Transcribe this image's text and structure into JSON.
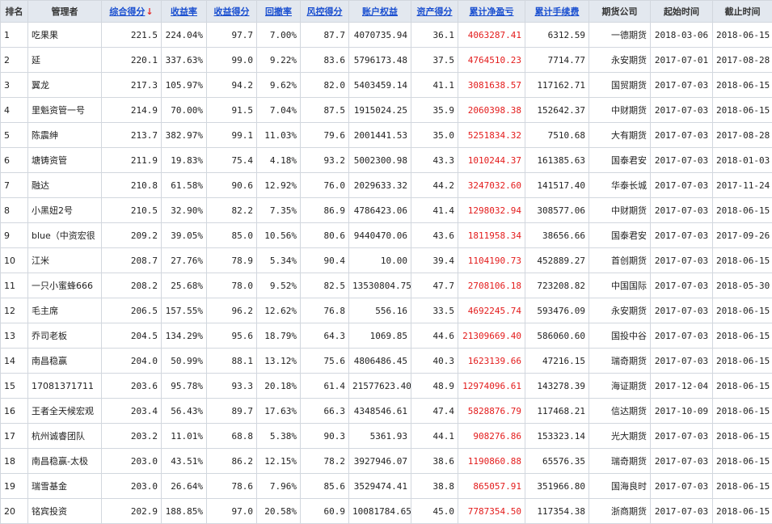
{
  "headers": {
    "rank": "排名",
    "manager": "管理者",
    "total_score": "综合得分",
    "sort_arrow": "↓",
    "return_rate": "收益率",
    "return_score": "收益得分",
    "drawdown": "回撤率",
    "risk_score": "风控得分",
    "equity": "账户权益",
    "asset_score": "资产得分",
    "net_profit": "累计净盈亏",
    "fees": "累计手续费",
    "company": "期货公司",
    "start": "起始时间",
    "end": "截止时间"
  },
  "rows": [
    {
      "rank": "1",
      "manager": "吃果果",
      "total": "221.5",
      "ret": "224.04%",
      "ret_score": "97.7",
      "dd": "7.00%",
      "risk": "87.7",
      "equity": "4070735.94",
      "asset": "36.1",
      "net": "4063287.41",
      "fees": "6312.59",
      "company": "一德期货",
      "start": "2018-03-06",
      "end": "2018-06-15"
    },
    {
      "rank": "2",
      "manager": "延",
      "total": "220.1",
      "ret": "337.63%",
      "ret_score": "99.0",
      "dd": "9.22%",
      "risk": "83.6",
      "equity": "5796173.48",
      "asset": "37.5",
      "net": "4764510.23",
      "fees": "7714.77",
      "company": "永安期货",
      "start": "2017-07-01",
      "end": "2017-08-28"
    },
    {
      "rank": "3",
      "manager": "翼龙",
      "total": "217.3",
      "ret": "105.97%",
      "ret_score": "94.2",
      "dd": "9.62%",
      "risk": "82.0",
      "equity": "5403459.14",
      "asset": "41.1",
      "net": "3081638.57",
      "fees": "117162.71",
      "company": "国贸期货",
      "start": "2017-07-03",
      "end": "2018-06-15"
    },
    {
      "rank": "4",
      "manager": "里魁资管一号",
      "total": "214.9",
      "ret": "70.00%",
      "ret_score": "91.5",
      "dd": "7.04%",
      "risk": "87.5",
      "equity": "1915024.25",
      "asset": "35.9",
      "net": "2060398.38",
      "fees": "152642.37",
      "company": "中财期货",
      "start": "2017-07-03",
      "end": "2018-06-15"
    },
    {
      "rank": "5",
      "manager": "陈震绅",
      "total": "213.7",
      "ret": "382.97%",
      "ret_score": "99.1",
      "dd": "11.03%",
      "risk": "79.6",
      "equity": "2001441.53",
      "asset": "35.0",
      "net": "5251834.32",
      "fees": "7510.68",
      "company": "大有期货",
      "start": "2017-07-03",
      "end": "2017-08-28"
    },
    {
      "rank": "6",
      "manager": "塘铸资管",
      "total": "211.9",
      "ret": "19.83%",
      "ret_score": "75.4",
      "dd": "4.18%",
      "risk": "93.2",
      "equity": "5002300.98",
      "asset": "43.3",
      "net": "1010244.37",
      "fees": "161385.63",
      "company": "国泰君安",
      "start": "2017-07-03",
      "end": "2018-01-03"
    },
    {
      "rank": "7",
      "manager": "融达",
      "total": "210.8",
      "ret": "61.58%",
      "ret_score": "90.6",
      "dd": "12.92%",
      "risk": "76.0",
      "equity": "2029633.32",
      "asset": "44.2",
      "net": "3247032.60",
      "fees": "141517.40",
      "company": "华泰长城",
      "start": "2017-07-03",
      "end": "2017-11-24"
    },
    {
      "rank": "8",
      "manager": "小黑妞2号",
      "total": "210.5",
      "ret": "32.90%",
      "ret_score": "82.2",
      "dd": "7.35%",
      "risk": "86.9",
      "equity": "4786423.06",
      "asset": "41.4",
      "net": "1298032.94",
      "fees": "308577.06",
      "company": "中财期货",
      "start": "2017-07-03",
      "end": "2018-06-15"
    },
    {
      "rank": "9",
      "manager": "blue（中资宏很",
      "total": "209.2",
      "ret": "39.05%",
      "ret_score": "85.0",
      "dd": "10.56%",
      "risk": "80.6",
      "equity": "9440470.06",
      "asset": "43.6",
      "net": "1811958.34",
      "fees": "38656.66",
      "company": "国泰君安",
      "start": "2017-07-03",
      "end": "2017-09-26"
    },
    {
      "rank": "10",
      "manager": "江米",
      "total": "208.7",
      "ret": "27.76%",
      "ret_score": "78.9",
      "dd": "5.34%",
      "risk": "90.4",
      "equity": "10.00",
      "asset": "39.4",
      "net": "1104190.73",
      "fees": "452889.27",
      "company": "首创期货",
      "start": "2017-07-03",
      "end": "2018-06-15"
    },
    {
      "rank": "11",
      "manager": "一只小蜜蜂666",
      "total": "208.2",
      "ret": "25.68%",
      "ret_score": "78.0",
      "dd": "9.52%",
      "risk": "82.5",
      "equity": "13530804.75",
      "asset": "47.7",
      "net": "2708106.18",
      "fees": "723208.82",
      "company": "中国国际",
      "start": "2017-07-03",
      "end": "2018-05-30"
    },
    {
      "rank": "12",
      "manager": "毛主席",
      "total": "206.5",
      "ret": "157.55%",
      "ret_score": "96.2",
      "dd": "12.62%",
      "risk": "76.8",
      "equity": "556.16",
      "asset": "33.5",
      "net": "4692245.74",
      "fees": "593476.09",
      "company": "永安期货",
      "start": "2017-07-03",
      "end": "2018-06-15"
    },
    {
      "rank": "13",
      "manager": "乔司老板",
      "total": "204.5",
      "ret": "134.29%",
      "ret_score": "95.6",
      "dd": "18.79%",
      "risk": "64.3",
      "equity": "1069.85",
      "asset": "44.6",
      "net": "21309669.40",
      "fees": "586060.60",
      "company": "国投中谷",
      "start": "2017-07-03",
      "end": "2018-06-15"
    },
    {
      "rank": "14",
      "manager": "南昌稳赢",
      "total": "204.0",
      "ret": "50.99%",
      "ret_score": "88.1",
      "dd": "13.12%",
      "risk": "75.6",
      "equity": "4806486.45",
      "asset": "40.3",
      "net": "1623139.66",
      "fees": "47216.15",
      "company": "瑞奇期货",
      "start": "2017-07-03",
      "end": "2018-06-15"
    },
    {
      "rank": "15",
      "manager": "17081371711",
      "total": "203.6",
      "ret": "95.78%",
      "ret_score": "93.3",
      "dd": "20.18%",
      "risk": "61.4",
      "equity": "21577623.40",
      "asset": "48.9",
      "net": "12974096.61",
      "fees": "143278.39",
      "company": "海证期货",
      "start": "2017-12-04",
      "end": "2018-06-15"
    },
    {
      "rank": "16",
      "manager": "王者全天候宏观",
      "total": "203.4",
      "ret": "56.43%",
      "ret_score": "89.7",
      "dd": "17.63%",
      "risk": "66.3",
      "equity": "4348546.61",
      "asset": "47.4",
      "net": "5828876.79",
      "fees": "117468.21",
      "company": "信达期货",
      "start": "2017-10-09",
      "end": "2018-06-15"
    },
    {
      "rank": "17",
      "manager": "杭州诚睿团队",
      "total": "203.2",
      "ret": "11.01%",
      "ret_score": "68.8",
      "dd": "5.38%",
      "risk": "90.3",
      "equity": "5361.93",
      "asset": "44.1",
      "net": "908276.86",
      "fees": "153323.14",
      "company": "光大期货",
      "start": "2017-07-03",
      "end": "2018-06-15"
    },
    {
      "rank": "18",
      "manager": "南昌稳赢-太极",
      "total": "203.0",
      "ret": "43.51%",
      "ret_score": "86.2",
      "dd": "12.15%",
      "risk": "78.2",
      "equity": "3927946.07",
      "asset": "38.6",
      "net": "1190860.88",
      "fees": "65576.35",
      "company": "瑞奇期货",
      "start": "2017-07-03",
      "end": "2018-06-15"
    },
    {
      "rank": "19",
      "manager": "瑞雪基金",
      "total": "203.0",
      "ret": "26.64%",
      "ret_score": "78.6",
      "dd": "7.96%",
      "risk": "85.6",
      "equity": "3529474.41",
      "asset": "38.8",
      "net": "865057.91",
      "fees": "351966.80",
      "company": "国海良时",
      "start": "2017-07-03",
      "end": "2018-06-15"
    },
    {
      "rank": "20",
      "manager": "铭宾投资",
      "total": "202.9",
      "ret": "188.85%",
      "ret_score": "97.0",
      "dd": "20.58%",
      "risk": "60.9",
      "equity": "10081784.65",
      "asset": "45.0",
      "net": "7787354.50",
      "fees": "117354.38",
      "company": "浙商期货",
      "start": "2017-07-03",
      "end": "2018-06-15"
    }
  ]
}
